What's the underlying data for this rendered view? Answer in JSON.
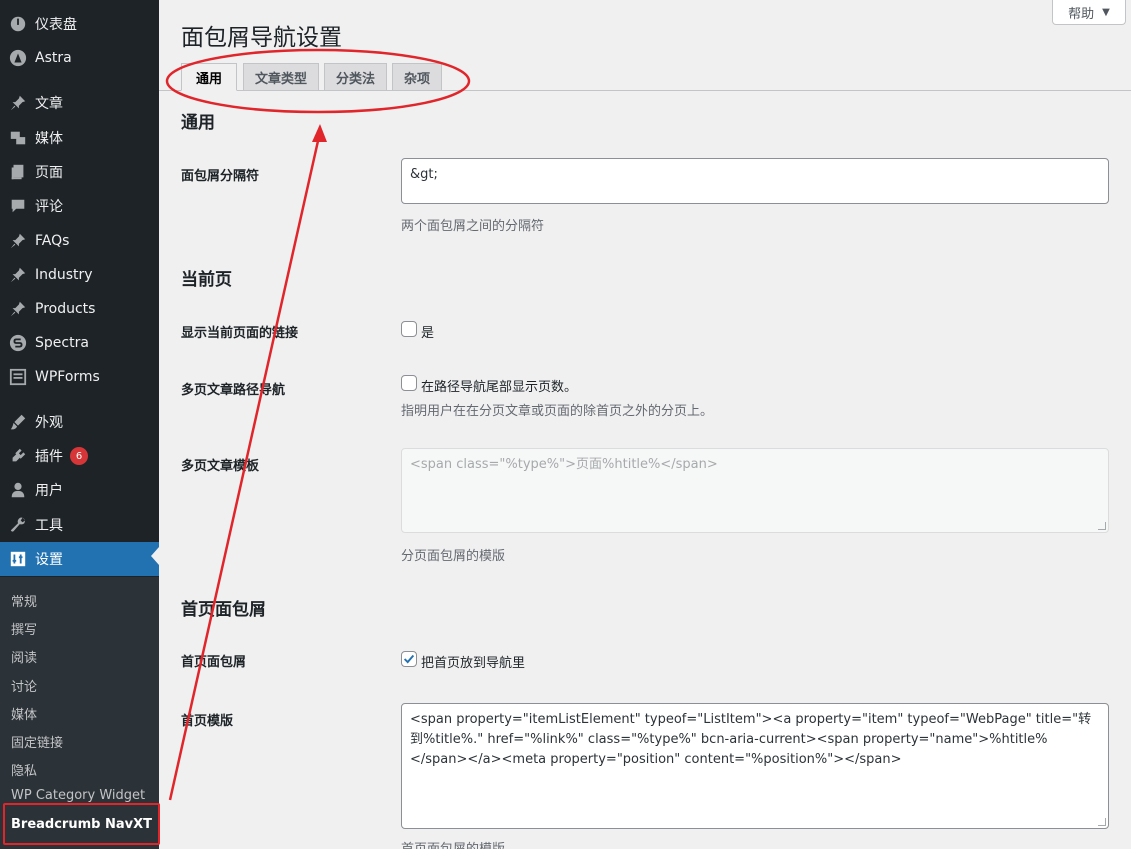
{
  "sidebar": {
    "items": [
      {
        "label": "仪表盘",
        "icon": "dashboard-icon"
      },
      {
        "label": "Astra",
        "icon": "astra-icon"
      },
      {
        "label": "文章",
        "icon": "pin-icon"
      },
      {
        "label": "媒体",
        "icon": "media-icon"
      },
      {
        "label": "页面",
        "icon": "page-icon"
      },
      {
        "label": "评论",
        "icon": "comment-icon"
      },
      {
        "label": "FAQs",
        "icon": "pin-icon"
      },
      {
        "label": "Industry",
        "icon": "pin-icon"
      },
      {
        "label": "Products",
        "icon": "pin-icon"
      },
      {
        "label": "Spectra",
        "icon": "spectra-icon"
      },
      {
        "label": "WPForms",
        "icon": "wpforms-icon"
      },
      {
        "label": "外观",
        "icon": "brush-icon"
      },
      {
        "label": "插件",
        "icon": "plugin-icon",
        "badge": "6"
      },
      {
        "label": "用户",
        "icon": "user-icon"
      },
      {
        "label": "工具",
        "icon": "wrench-icon"
      },
      {
        "label": "设置",
        "icon": "settings-icon",
        "active": true
      }
    ],
    "submenu": [
      "常规",
      "撰写",
      "阅读",
      "讨论",
      "媒体",
      "固定链接",
      "隐私",
      "WP Category Widget",
      "Breadcrumb NavXT"
    ]
  },
  "header": {
    "help_label": "帮助",
    "help_caret": "▼",
    "title": "面包屑导航设置"
  },
  "tabs": [
    "通用",
    "文章类型",
    "分类法",
    "杂项"
  ],
  "sections": {
    "general": {
      "heading": "通用",
      "separator_label": "面包屑分隔符",
      "separator_value": "&gt;",
      "separator_desc": "两个面包屑之间的分隔符"
    },
    "current": {
      "heading": "当前页",
      "link_label": "显示当前页面的链接",
      "link_cb_label": "是",
      "paged_label": "多页文章路径导航",
      "paged_cb_label": "在路径导航尾部显示页数。",
      "paged_desc": "指明用户在在分页文章或页面的除首页之外的分页上。",
      "paged_tpl_label": "多页文章模板",
      "paged_tpl_value": "<span class=\"%type%\">页面%htitle%</span>",
      "paged_tpl_desc": "分页面包屑的模版"
    },
    "home": {
      "heading": "首页面包屑",
      "home_label": "首页面包屑",
      "home_cb_label": "把首页放到导航里",
      "home_tpl_label": "首页模版",
      "home_tpl_value": "<span property=\"itemListElement\" typeof=\"ListItem\"><a property=\"item\" typeof=\"WebPage\" title=\"转到%title%.\" href=\"%link%\" class=\"%type%\" bcn-aria-current><span property=\"name\">%htitle%</span></a><meta property=\"position\" content=\"%position%\"></span>",
      "home_tpl_desc": "首页面包屑的模版"
    }
  },
  "colors": {
    "sidebar_bg": "#1d2327",
    "accent": "#2271b1",
    "annotation_red": "#e0262b"
  }
}
